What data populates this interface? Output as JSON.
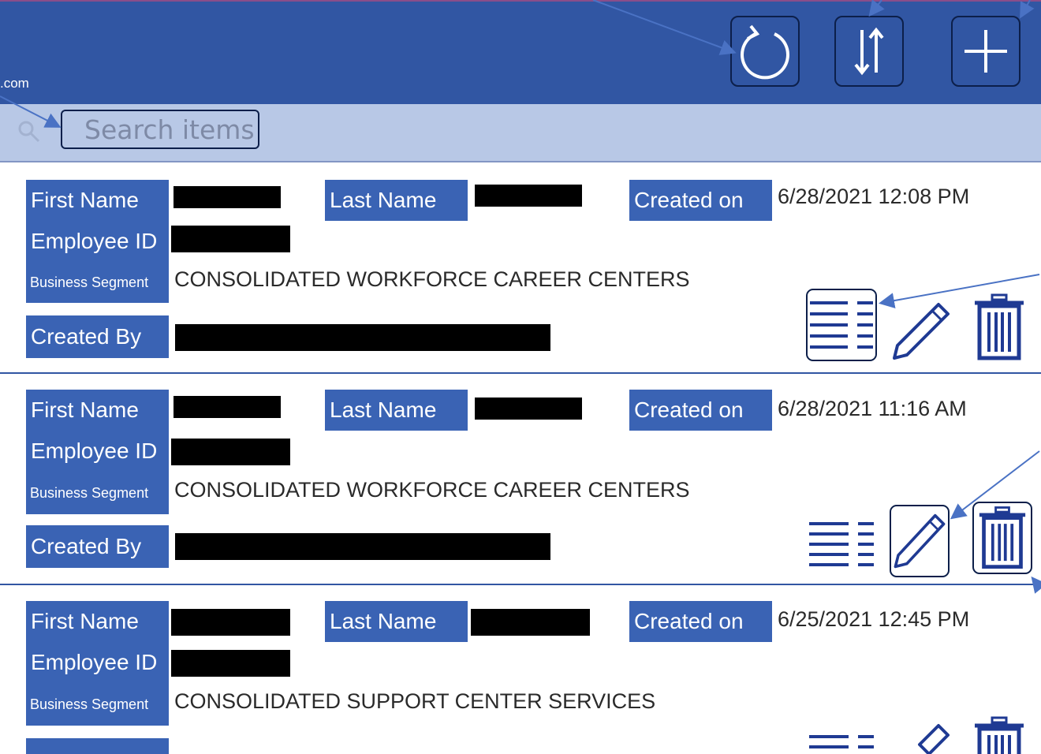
{
  "header": {
    "user_email": ".com",
    "refresh_icon": "refresh-icon",
    "sort_icon": "sort-icon",
    "add_icon": "plus-icon"
  },
  "search": {
    "placeholder": "Search items",
    "icon": "search-icon"
  },
  "labels": {
    "first_name": "First Name",
    "last_name": "Last Name",
    "created_on": "Created on",
    "employee_id": "Employee ID",
    "business_segment": "Business Segment",
    "created_by": "Created By"
  },
  "records": [
    {
      "created_on": "6/28/2021 12:08 PM",
      "business_segment": "CONSOLIDATED WORKFORCE CAREER CENTERS"
    },
    {
      "created_on": "6/28/2021 11:16 AM",
      "business_segment": "CONSOLIDATED WORKFORCE CAREER CENTERS"
    },
    {
      "created_on": "6/25/2021 12:45 PM",
      "business_segment": "CONSOLIDATED SUPPORT CENTER SERVICES"
    }
  ],
  "colors": {
    "header_bg": "#3156a3",
    "label_bg": "#3a63b4",
    "search_bar_bg": "#b8c8e6",
    "icon_color": "#1f3a93",
    "annotation_arrow": "#4a72c4"
  }
}
